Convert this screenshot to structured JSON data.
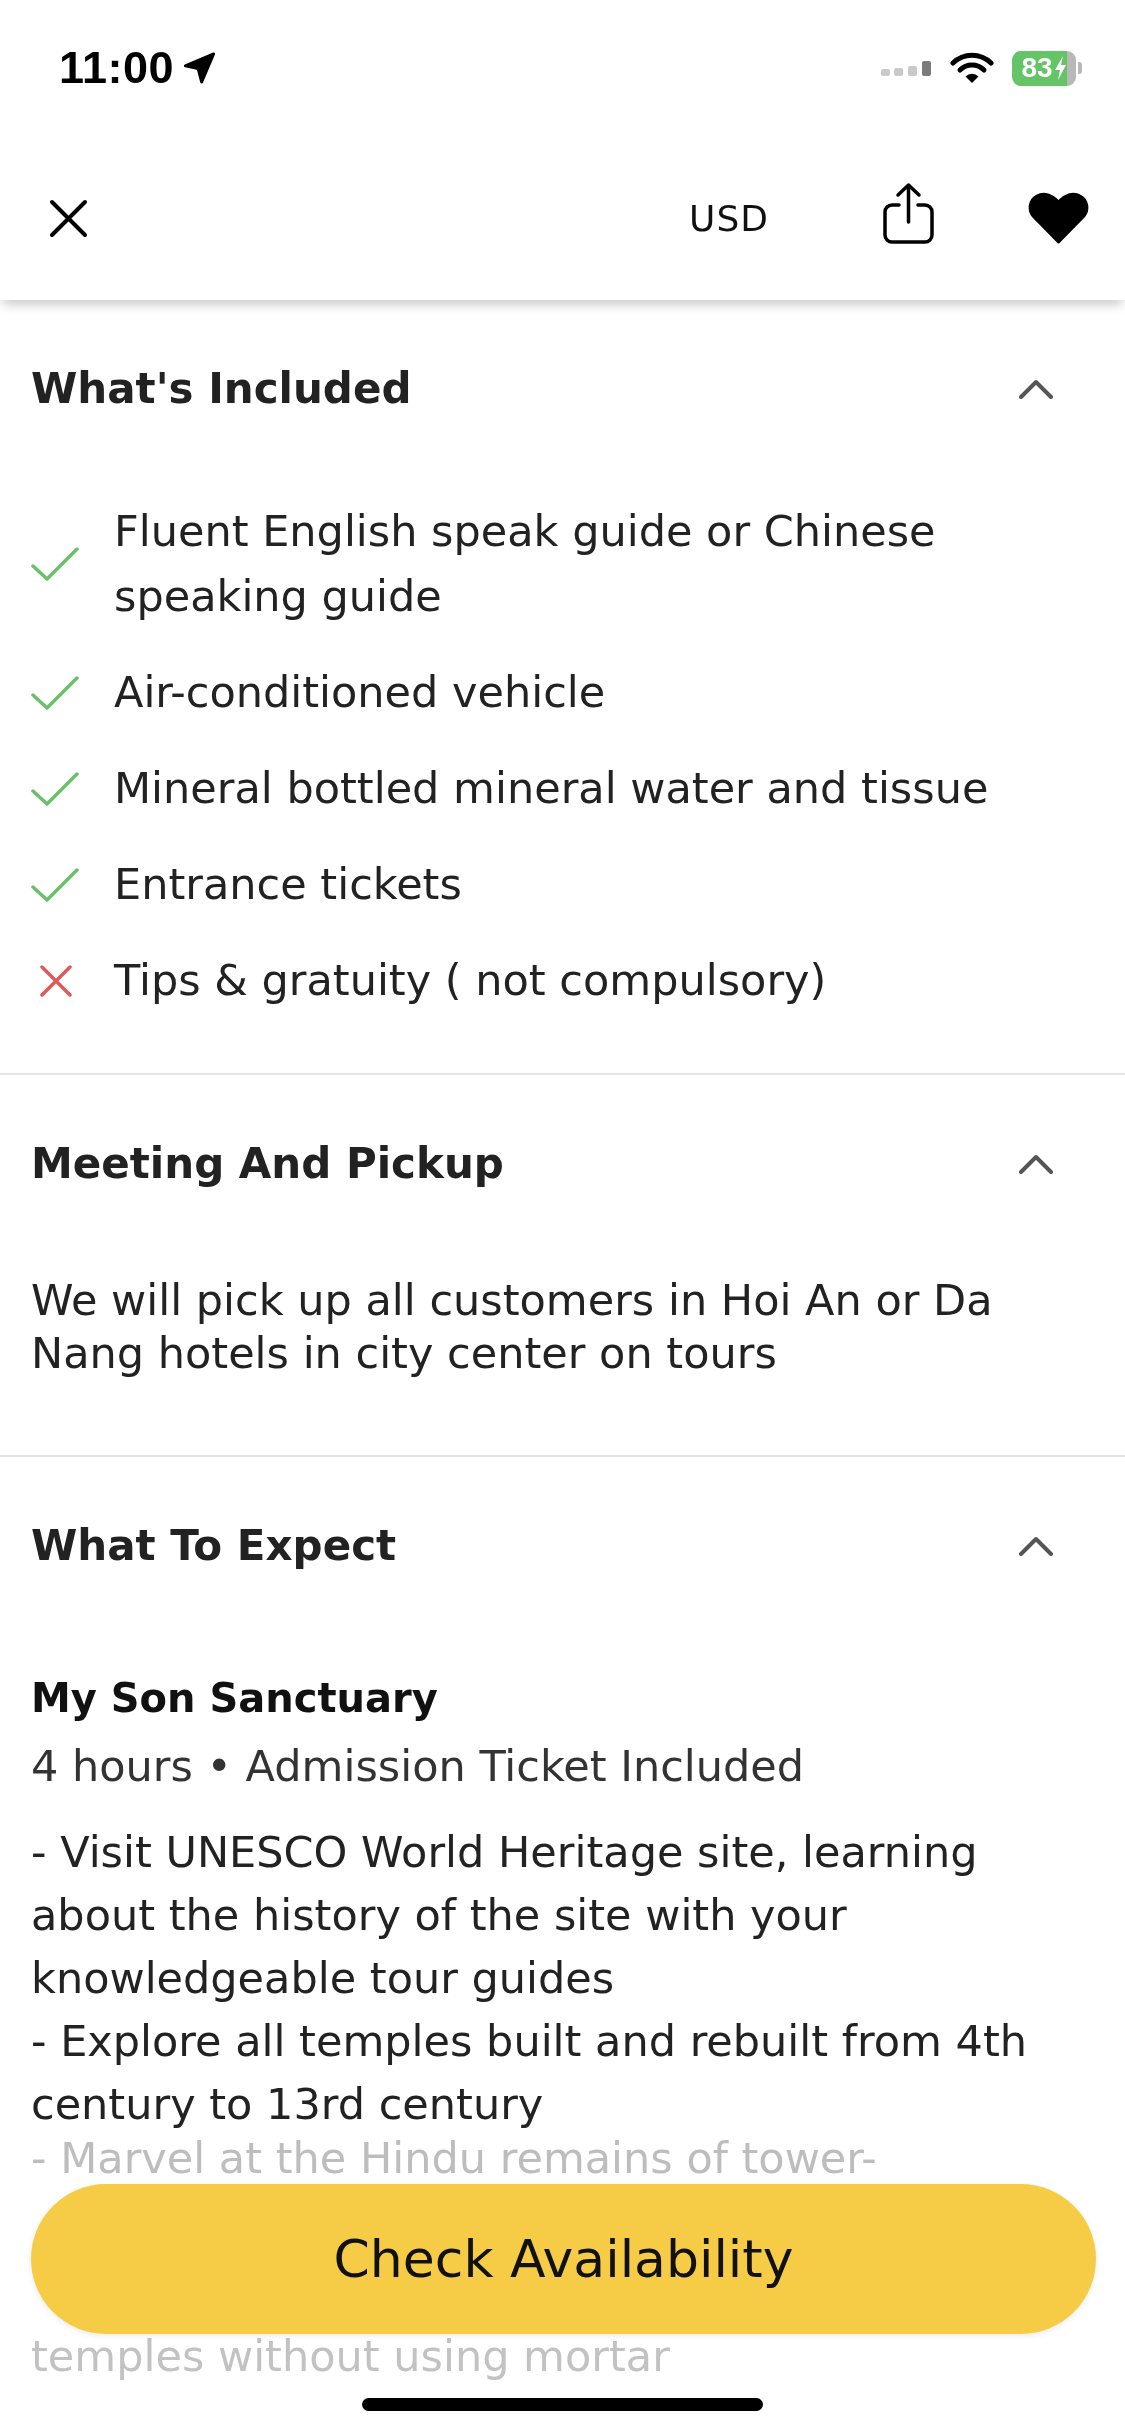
{
  "status_bar": {
    "time": "11:00",
    "battery": "83"
  },
  "nav_bar": {
    "currency": "USD",
    "favorite": true
  },
  "sections": [
    {
      "kind": "checklist",
      "title": "What's Included",
      "expanded": true,
      "items": [
        {
          "text": "Fluent English speak guide or Chinese speaking guide",
          "included": true
        },
        {
          "text": "Air-conditioned vehicle",
          "included": true
        },
        {
          "text": "Mineral bottled mineral water and tissue",
          "included": true
        },
        {
          "text": "Entrance tickets",
          "included": true
        },
        {
          "text": "Tips & gratuity ( not compulsory)",
          "included": false
        }
      ]
    },
    {
      "kind": "text",
      "title": "Meeting And Pickup",
      "expanded": true,
      "text": "We will pick up all customers in Hoi An or Da Nang hotels in city center on tours"
    },
    {
      "kind": "stops",
      "title": "What To Expect",
      "expanded": true,
      "stops": [
        {
          "name": "My Son Sanctuary",
          "meta": "4 hours • Admission Ticket Included",
          "lines": [
            {
              "text": "- Visit UNESCO World Heritage site, learning about the history of the site with your knowledgeable tour guides",
              "faded": false
            },
            {
              "text": "- Explore all temples built and rebuilt from 4th century to 13rd century",
              "faded": false
            },
            {
              "text": "- Marvel at the Hindu remains of tower-",
              "faded": true
            },
            {
              "text": "temples without using mortar",
              "faded": true
            }
          ]
        }
      ]
    }
  ],
  "footer": {
    "button": "Check Availability"
  }
}
